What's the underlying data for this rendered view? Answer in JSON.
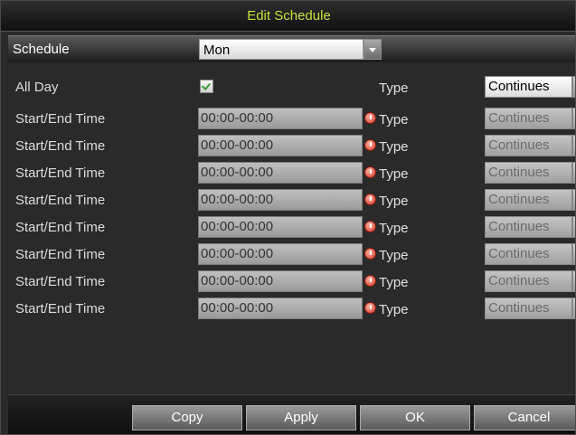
{
  "dialog": {
    "title": "Edit Schedule"
  },
  "schedule": {
    "label": "Schedule",
    "value": "Mon"
  },
  "all_day": {
    "label": "All Day",
    "checked": true,
    "type_label": "Type",
    "type_value": "Continues"
  },
  "rows": [
    {
      "label": "Start/End Time",
      "time": "00:00-00:00",
      "type_label": "Type",
      "type_value": "Continues"
    },
    {
      "label": "Start/End Time",
      "time": "00:00-00:00",
      "type_label": "Type",
      "type_value": "Continues"
    },
    {
      "label": "Start/End Time",
      "time": "00:00-00:00",
      "type_label": "Type",
      "type_value": "Continues"
    },
    {
      "label": "Start/End Time",
      "time": "00:00-00:00",
      "type_label": "Type",
      "type_value": "Continues"
    },
    {
      "label": "Start/End Time",
      "time": "00:00-00:00",
      "type_label": "Type",
      "type_value": "Continues"
    },
    {
      "label": "Start/End Time",
      "time": "00:00-00:00",
      "type_label": "Type",
      "type_value": "Continues"
    },
    {
      "label": "Start/End Time",
      "time": "00:00-00:00",
      "type_label": "Type",
      "type_value": "Continues"
    },
    {
      "label": "Start/End Time",
      "time": "00:00-00:00",
      "type_label": "Type",
      "type_value": "Continues"
    }
  ],
  "buttons": {
    "copy": "Copy",
    "apply": "Apply",
    "ok": "OK",
    "cancel": "Cancel"
  },
  "icons": {
    "checkbox": "check-icon",
    "time": "clock-icon",
    "dropdown": "chevron-down-icon"
  },
  "colors": {
    "title": "#c6e23a",
    "clock": "#d23a2a",
    "check": "#3a9a3a"
  }
}
